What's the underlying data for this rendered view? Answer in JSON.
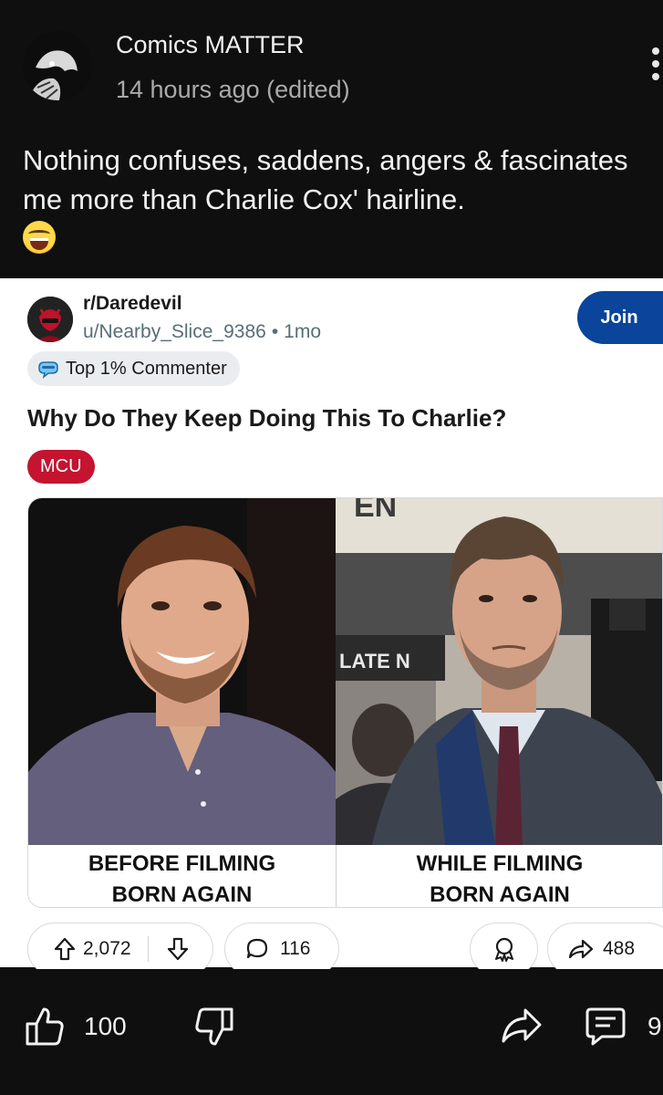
{
  "post": {
    "author": "Comics MATTER",
    "time": "14 hours ago (edited)",
    "text": "Nothing confuses, saddens, angers & fascinates me more than Charlie Cox' hairline.",
    "emoji": "laughing-tears-emoji"
  },
  "embed": {
    "subreddit": "r/Daredevil",
    "username": "u/Nearby_Slice_9386",
    "age": "1mo",
    "join_label": "Join",
    "user_flair": "Top 1% Commenter",
    "title": "Why Do They Keep Doing This To Charlie?",
    "tag": "MCU",
    "image": {
      "caption_left_line1": "BEFORE FILMING",
      "caption_left_line2": "BORN AGAIN",
      "caption_right_line1": "WHILE FILMING",
      "caption_right_line2": "BORN AGAIN",
      "background_sign": "LATE N"
    },
    "upvotes": "2,072",
    "comments": "116",
    "shares": "488"
  },
  "actions": {
    "likes": "100",
    "comments": "9"
  },
  "colors": {
    "dark_bg": "#0f0f0f",
    "join_blue": "#0a449b",
    "tag_red": "#c4142f"
  }
}
